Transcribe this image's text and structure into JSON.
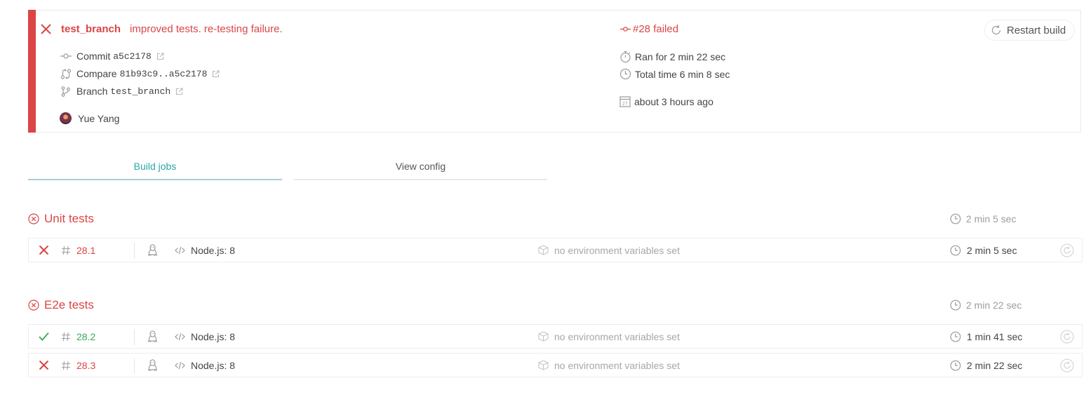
{
  "build": {
    "branch": "test_branch",
    "commit_message": "improved tests. re-testing failure.",
    "commit_label": "Commit",
    "commit_hash": "a5c2178",
    "compare_label": "Compare",
    "compare_range": "81b93c9..a5c2178",
    "branch_label": "Branch",
    "branch_value": "test_branch",
    "author": "Yue Yang",
    "status": "#28 failed",
    "ran_for": "Ran for 2 min 22 sec",
    "total_time": "Total time 6 min 8 sec",
    "finished": "about 3 hours ago",
    "restart_label": "Restart build",
    "accent": "#db4545"
  },
  "tabs": {
    "build_jobs": "Build jobs",
    "view_config": "View config"
  },
  "stages": [
    {
      "name": "Unit tests",
      "duration": "2 min 5 sec",
      "jobs": [
        {
          "state": "failed",
          "number": "28.1",
          "os_icon": "linux-icon",
          "language": "Node.js: 8",
          "env": "no environment variables set",
          "duration": "2 min 5 sec"
        }
      ]
    },
    {
      "name": "E2e tests",
      "duration": "2 min 22 sec",
      "jobs": [
        {
          "state": "passed",
          "number": "28.2",
          "os_icon": "linux-icon",
          "language": "Node.js: 8",
          "env": "no environment variables set",
          "duration": "1 min 41 sec"
        },
        {
          "state": "failed",
          "number": "28.3",
          "os_icon": "linux-icon",
          "language": "Node.js: 8",
          "env": "no environment variables set",
          "duration": "2 min 22 sec"
        }
      ]
    }
  ]
}
